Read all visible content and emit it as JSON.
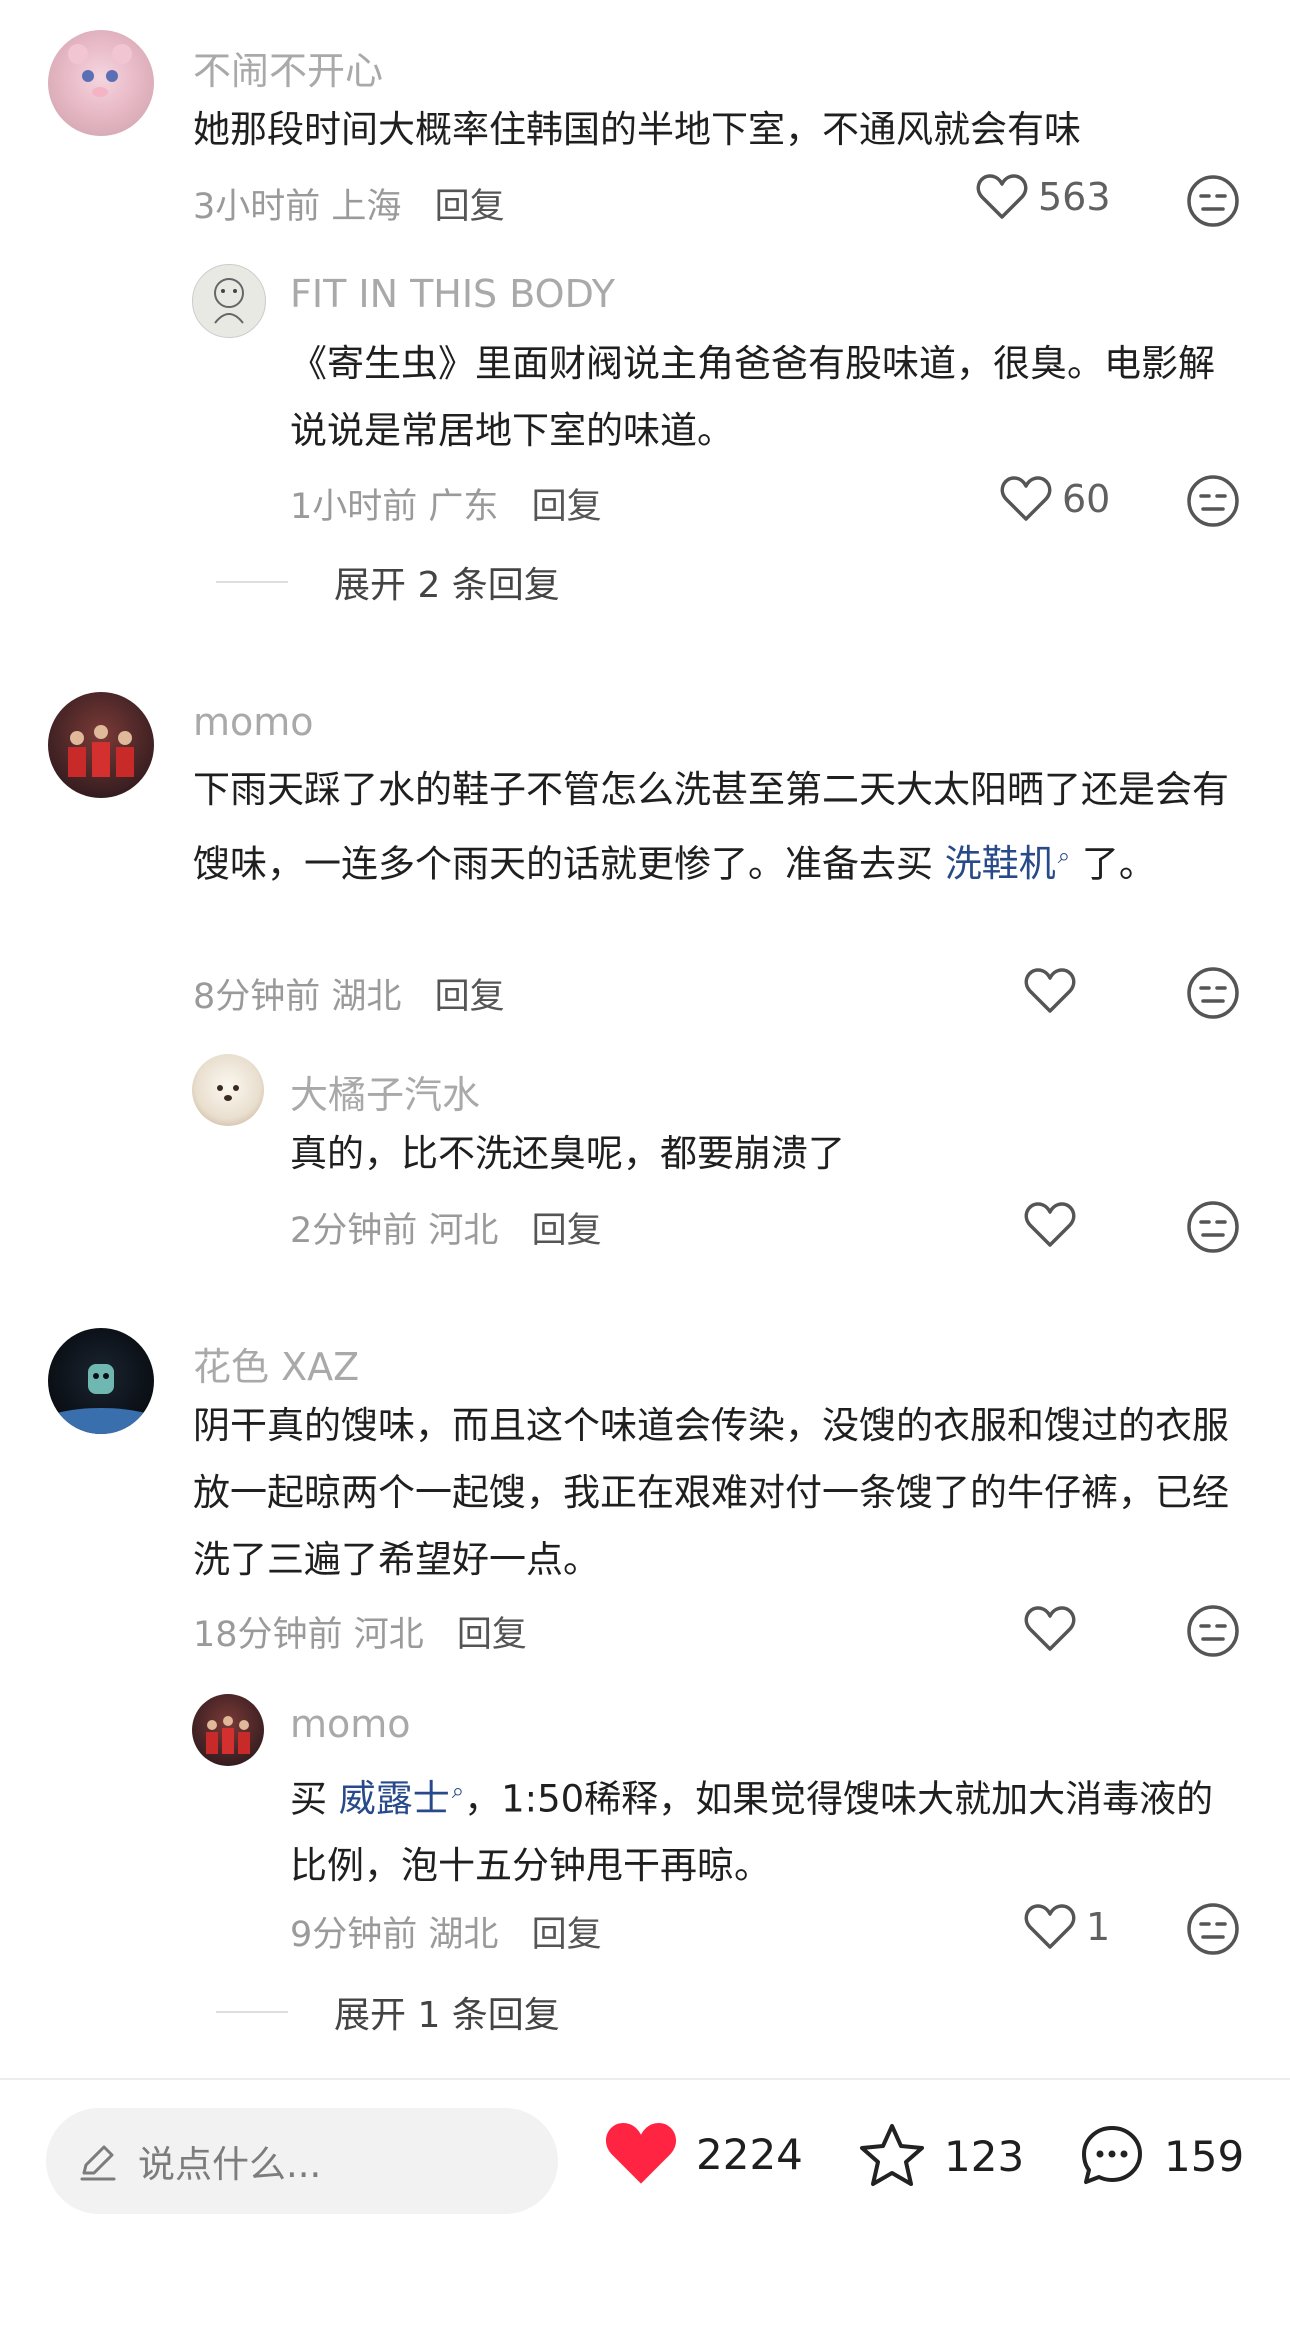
{
  "comments": [
    {
      "user": "不闹不开心",
      "text": "她那段时间大概率住韩国的半地下室，不通风就会有味",
      "time": "3小时前",
      "location": "上海",
      "reply_label": "回复",
      "likes": "563",
      "replies": [
        {
          "user": "FIT IN THIS BODY",
          "text": "《寄生虫》里面财阀说主角爸爸有股味道，很臭。电影解说说是常居地下室的味道。",
          "time": "1小时前",
          "location": "广东",
          "reply_label": "回复",
          "likes": "60"
        }
      ],
      "expand_label": "展开 2 条回复"
    },
    {
      "user": "momo",
      "text_before": "下雨天踩了水的鞋子不管怎么洗甚至第二天大太阳晒了还是会有馊味，一连多个雨天的话就更惨了。准备去买 ",
      "link": "洗鞋机",
      "text_after": " 了。",
      "time": "8分钟前",
      "location": "湖北",
      "reply_label": "回复",
      "replies": [
        {
          "user": "大橘子汽水",
          "text": "真的，比不洗还臭呢，都要崩溃了",
          "time": "2分钟前",
          "location": "河北",
          "reply_label": "回复"
        }
      ]
    },
    {
      "user": "花色 XAZ",
      "text": "阴干真的馊味，而且这个味道会传染，没馊的衣服和馊过的衣服放一起晾两个一起馊，我正在艰难对付一条馊了的牛仔裤，已经洗了三遍了希望好一点。",
      "time": "18分钟前",
      "location": "河北",
      "reply_label": "回复",
      "replies": [
        {
          "user": "momo",
          "text_before": "买 ",
          "link": "威露士",
          "text_after": "，1:50稀释，如果觉得馊味大就加大消毒液的比例，泡十五分钟甩干再晾。",
          "time": "9分钟前",
          "location": "湖北",
          "reply_label": "回复",
          "likes": "1"
        }
      ],
      "expand_label": "展开 1 条回复"
    }
  ],
  "bottom_bar": {
    "input_placeholder": "说点什么...",
    "likes": "2224",
    "favorites": "123",
    "comments": "159",
    "like_color": "#ff2442"
  },
  "colors": {
    "username": "#a9a9a9",
    "link": "#284a8a",
    "meta": "#9a9a9a"
  }
}
